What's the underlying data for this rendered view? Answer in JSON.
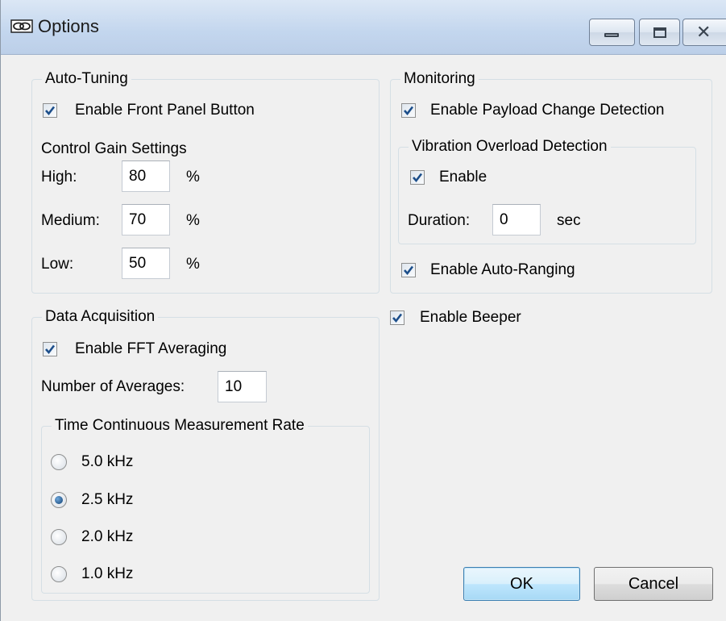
{
  "window": {
    "title": "Options",
    "icon": "link-icon"
  },
  "auto_tuning": {
    "title": "Auto-Tuning",
    "front_panel": {
      "label": "Enable Front Panel Button",
      "checked": true
    },
    "gain_heading": "Control Gain Settings",
    "rows": [
      {
        "label": "High:",
        "value": "80",
        "unit": "%"
      },
      {
        "label": "Medium:",
        "value": "70",
        "unit": "%"
      },
      {
        "label": "Low:",
        "value": "50",
        "unit": "%"
      }
    ]
  },
  "monitoring": {
    "title": "Monitoring",
    "payload": {
      "label": "Enable Payload Change Detection",
      "checked": true
    },
    "vibration": {
      "title": "Vibration Overload Detection",
      "enable": {
        "label": "Enable",
        "checked": true
      },
      "duration_label": "Duration:",
      "duration_value": "0",
      "duration_unit": "sec"
    },
    "auto_ranging": {
      "label": "Enable Auto-Ranging",
      "checked": true
    }
  },
  "beeper": {
    "label": "Enable Beeper",
    "checked": true
  },
  "data_acquisition": {
    "title": "Data Acquisition",
    "fft": {
      "label": "Enable FFT Averaging",
      "checked": true
    },
    "averages_label": "Number of Averages:",
    "averages_value": "10",
    "rate": {
      "title": "Time Continuous Measurement Rate",
      "options": [
        "5.0 kHz",
        "2.5 kHz",
        "2.0 kHz",
        "1.0 kHz"
      ],
      "selected": "2.5 kHz"
    }
  },
  "buttons": {
    "ok": "OK",
    "cancel": "Cancel"
  },
  "colors": {
    "accent_check": "#1c4e8a",
    "group_border": "#d5dfe5",
    "titlebar": "#c3d6ee"
  }
}
